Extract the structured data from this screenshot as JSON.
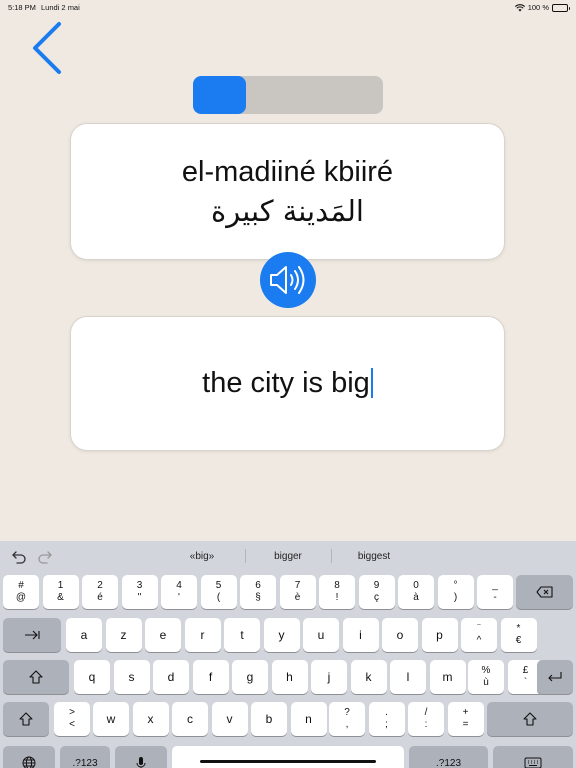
{
  "status": {
    "time": "5:18 PM",
    "date": "Lundi 2 mai",
    "battery": "100 %"
  },
  "lesson": {
    "progress": 0.28
  },
  "card": {
    "latin": "el-madiiné kbiiré",
    "arabic": "المَدينة كبيرة"
  },
  "answer": {
    "value": "the city is big"
  },
  "suggestions": [
    "«big»",
    "bigger",
    "biggest"
  ],
  "keyboard": {
    "row1": [
      {
        "top": "#",
        "bot": "@"
      },
      {
        "top": "1",
        "bot": "&"
      },
      {
        "top": "2",
        "bot": "é"
      },
      {
        "top": "3",
        "bot": "\""
      },
      {
        "top": "4",
        "bot": "'"
      },
      {
        "top": "5",
        "bot": "("
      },
      {
        "top": "6",
        "bot": "§"
      },
      {
        "top": "7",
        "bot": "è"
      },
      {
        "top": "8",
        "bot": "!"
      },
      {
        "top": "9",
        "bot": "ç"
      },
      {
        "top": "0",
        "bot": "à"
      },
      {
        "top": "°",
        "bot": ")"
      },
      {
        "top": "_",
        "bot": "-"
      }
    ],
    "row2": [
      "a",
      "z",
      "e",
      "r",
      "t",
      "y",
      "u",
      "i",
      "o",
      "p"
    ],
    "row2_extra": [
      {
        "top": "¨",
        "bot": "^"
      },
      {
        "top": "*",
        "bot": "€"
      }
    ],
    "row3": [
      "q",
      "s",
      "d",
      "f",
      "g",
      "h",
      "j",
      "k",
      "l",
      "m"
    ],
    "row3_extra": [
      {
        "top": "%",
        "bot": "ù"
      },
      {
        "top": "£",
        "bot": "`"
      }
    ],
    "row4_extra": [
      {
        "top": ">",
        "bot": "<"
      }
    ],
    "row4": [
      "w",
      "x",
      "c",
      "v",
      "b",
      "n"
    ],
    "row4_punct": [
      {
        "top": "?",
        "bot": ","
      },
      {
        "top": ".",
        "bot": ";"
      },
      {
        "top": "/",
        "bot": ":"
      },
      {
        "top": "+",
        "bot": "="
      }
    ],
    "numbers_label": ".?123"
  }
}
